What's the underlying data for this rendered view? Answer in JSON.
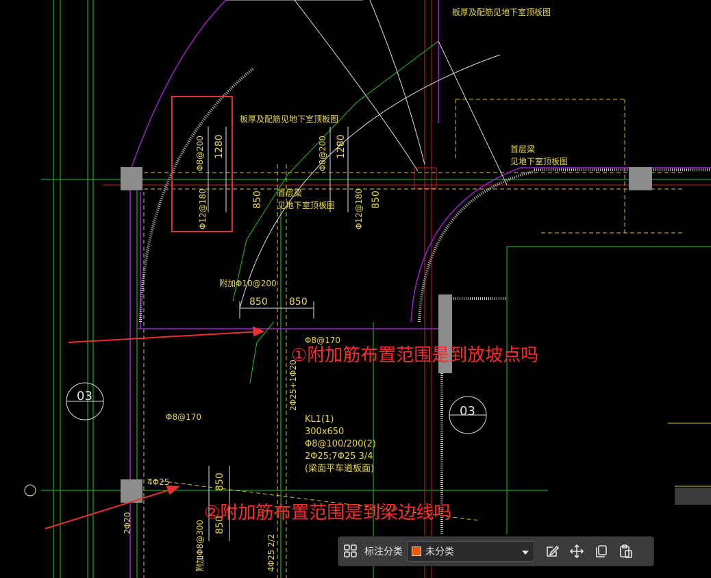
{
  "drawing": {
    "annotations": {
      "note1": "①附加筋布置范围是到放坡点吗",
      "note2": "②附加筋布置范围是到梁边线吗"
    },
    "labels": {
      "slab_note_top": "板厚及配筋见地下室顶板图",
      "slab_note_mid": "板厚及配筋见地下室顶板图",
      "first_floor_beam_a": "首层梁",
      "first_floor_beam_a2": "见地下室顶板图",
      "rebar_a": "Φ8@200",
      "rebar_b": "Φ8@200",
      "dim_1280_a": "1280",
      "dim_1280_b": "1280",
      "rebar_c": "Φ12@180",
      "rebar_d": "Φ12@180",
      "dim_850_a": "850",
      "dim_850_b": "850",
      "add_rebar": "附加Φ10@200",
      "dim_850_c": "850",
      "dim_850_d": "850",
      "rebar_e": "Φ8@170",
      "rebar_f": "Φ8@170",
      "beam_rebar": "2Φ25+1Φ20",
      "kl_name": "KL1(1)",
      "kl_size": "300x650",
      "kl_stirrup": "Φ8@100/200(2)",
      "kl_bars": "2Φ25;7Φ25 3/4",
      "kl_note": "(梁面平车道板面)",
      "bars_4phi25": "4Φ25",
      "dim_850_e": "850",
      "dim_850_f": "850",
      "bars_2phi20": "2Φ20",
      "add_rebar2": "附加Φ8@300",
      "bars_4phi25b": "4Φ25 2/2",
      "axis_03_a": "03",
      "axis_03_b": "03",
      "first_floor_beam_b": "首层梁",
      "first_floor_beam_b2": "见地下室顶板图"
    }
  },
  "toolbar": {
    "category_label": "标注分类",
    "category_value": "未分类",
    "category_color": "#e8590c"
  }
}
